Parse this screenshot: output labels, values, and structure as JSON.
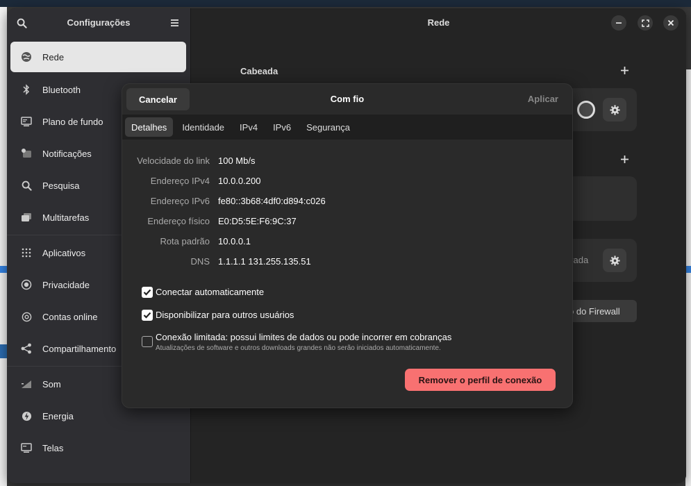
{
  "sidebar": {
    "title": "Configurações",
    "items": [
      {
        "label": "Rede",
        "icon": "network-icon"
      },
      {
        "label": "Bluetooth",
        "icon": "bluetooth-icon"
      },
      {
        "label": "Plano de fundo",
        "icon": "display-icon"
      },
      {
        "label": "Notificações",
        "icon": "notification-icon"
      },
      {
        "label": "Pesquisa",
        "icon": "search-icon"
      },
      {
        "label": "Multitarefas",
        "icon": "multitask-icon"
      },
      {
        "label": "Aplicativos",
        "icon": "apps-grid-icon"
      },
      {
        "label": "Privacidade",
        "icon": "privacy-icon"
      },
      {
        "label": "Contas online",
        "icon": "at-icon"
      },
      {
        "label": "Compartilhamento",
        "icon": "share-icon"
      },
      {
        "label": "Som",
        "icon": "sound-icon"
      },
      {
        "label": "Energia",
        "icon": "power-icon"
      },
      {
        "label": "Telas",
        "icon": "screen-icon"
      }
    ]
  },
  "content": {
    "title": "Rede",
    "section_wired": "Cabeada",
    "vpn_partial_text": "vada",
    "firewall_partial": "o do Firewall"
  },
  "dialog": {
    "cancel_label": "Cancelar",
    "title": "Com fio",
    "apply_label": "Aplicar",
    "tabs": [
      "Detalhes",
      "Identidade",
      "IPv4",
      "IPv6",
      "Segurança"
    ],
    "details": [
      {
        "label": "Velocidade do link",
        "value": "100 Mb/s"
      },
      {
        "label": "Endereço IPv4",
        "value": "10.0.0.200"
      },
      {
        "label": "Endereço IPv6",
        "value": "fe80::3b68:4df0:d894:c026"
      },
      {
        "label": "Endereço físico",
        "value": "E0:D5:5E:F6:9C:37"
      },
      {
        "label": "Rota padrão",
        "value": "10.0.0.1"
      },
      {
        "label": "DNS",
        "value": "1.1.1.1 131.255.135.51"
      }
    ],
    "auto_connect": {
      "label": "Conectar automaticamente",
      "checked": true
    },
    "share_users": {
      "label": "Disponibilizar para outros usuários",
      "checked": true
    },
    "metered": {
      "label": "Conexão limitada: possui limites de dados ou pode incorrer em cobranças",
      "sub": "Atualizações de software e outros downloads grandes não serão iniciados automaticamente.",
      "checked": false
    },
    "remove_label": "Remover o perfil de conexão"
  },
  "colors": {
    "destructive": "#f87171",
    "window_bg": "#242424",
    "sidebar_bg": "#2e2e32"
  }
}
